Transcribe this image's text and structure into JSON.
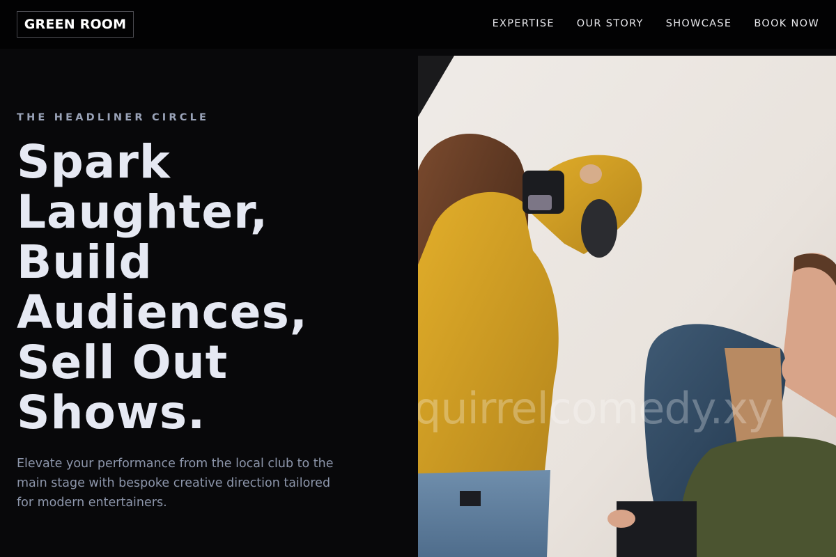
{
  "header": {
    "logo": "GREEN ROOM",
    "nav": [
      "EXPERTISE",
      "OUR STORY",
      "SHOWCASE",
      "BOOK NOW"
    ]
  },
  "hero": {
    "eyebrow": "THE HEADLINER CIRCLE",
    "headline_lines": [
      "Spark",
      "Laughter,",
      "Build",
      "Audiences,",
      "Sell Out",
      "Shows."
    ],
    "subtitle": "Elevate your performance from the local club to the main stage with bespoke creative direction tailored for modern entertainers.",
    "image": {
      "description": "Photographer in yellow sweater shooting a seated model in denim jacket",
      "watermark": "quirrelcomedy.xy"
    }
  },
  "colors": {
    "background": "#08080a",
    "header_bg": "#020203",
    "heading": "#e6e9f3",
    "eyebrow": "#9aa3b8",
    "body_text": "#8d96ab"
  }
}
